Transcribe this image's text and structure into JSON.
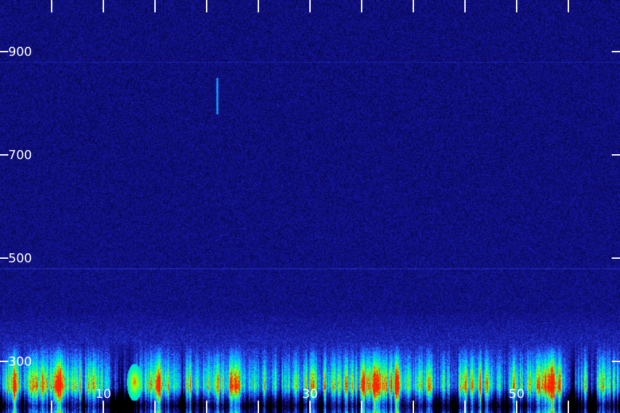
{
  "chart_data": {
    "type": "heatmap",
    "title": "",
    "xlabel": "",
    "ylabel": "",
    "y_ticks": [
      900,
      700,
      500,
      300
    ],
    "x_tick_labels": [
      10,
      30,
      50
    ],
    "xlim": [
      0,
      60
    ],
    "ylim": [
      200,
      1000
    ],
    "grid": false,
    "legend": "none",
    "colormap": [
      "#000000",
      "#0a0a6e",
      "#1a1aa8",
      "#2b5cff",
      "#00c8ff",
      "#00ff9a",
      "#b4ff00",
      "#ff2000"
    ],
    "intensity_profile": [
      {
        "y": 1000,
        "level": 0.18
      },
      {
        "y": 700,
        "level": 0.18
      },
      {
        "y": 500,
        "level": 0.19
      },
      {
        "y": 400,
        "level": 0.2
      },
      {
        "y": 330,
        "level": 0.3
      },
      {
        "y": 300,
        "level": 0.45
      },
      {
        "y": 270,
        "level": 0.62
      },
      {
        "y": 250,
        "level": 0.66
      },
      {
        "y": 235,
        "level": 0.4
      },
      {
        "y": 215,
        "level": 0.05
      },
      {
        "y": 200,
        "level": 0.25
      }
    ],
    "features": [
      {
        "label": "hot-spot",
        "x": 13,
        "y": 260,
        "level": 1.0
      },
      {
        "label": "streak",
        "x": 21,
        "y_from": 780,
        "y_to": 850,
        "level": 0.55
      },
      {
        "label": "horizontal-line",
        "y": 880,
        "level": 0.35
      },
      {
        "label": "horizontal-line",
        "y": 480,
        "level": 0.4
      }
    ]
  }
}
